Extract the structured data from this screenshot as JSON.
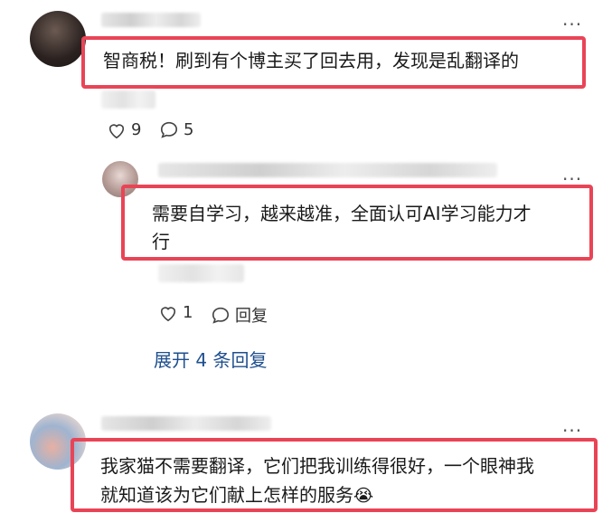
{
  "comments": [
    {
      "text": "智商税！刷到有个博主买了回去用，发现是乱翻译的",
      "like_count": "9",
      "reply_count": "5"
    },
    {
      "text_line1": "需要自学习，越来越准，全面认可AI学习能力才",
      "text_line2": "行",
      "like_count": "1",
      "reply_label": "回复",
      "expand_label": "展开 4 条回复"
    },
    {
      "text_line1": "我家猫不需要翻译，它们把我训练得很好，一个眼神我",
      "text_line2": "就知道该为它们献上怎样的服务",
      "emoji_char": "😭"
    }
  ],
  "icons": {
    "more": "more-dots-icon",
    "like": "heart-outline-icon",
    "comment": "speech-bubble-icon",
    "emoji": "crying-face-emoji"
  },
  "colors": {
    "highlight_border": "#e94456",
    "expand_link": "#1f4f8f"
  }
}
